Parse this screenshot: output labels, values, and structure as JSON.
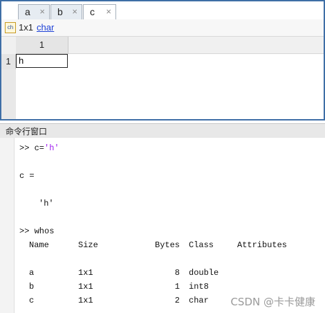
{
  "tabs": [
    {
      "label": "a",
      "active": false
    },
    {
      "label": "b",
      "active": false
    },
    {
      "label": "c",
      "active": true
    }
  ],
  "tab_close_glyph": "×",
  "variable_info": {
    "icon": "char-icon",
    "icon_text": "ch",
    "size": "1x1",
    "class": "char"
  },
  "grid": {
    "column_header": "1",
    "row_header": "1",
    "cell_value": "h"
  },
  "command_window": {
    "title": "命令行窗口",
    "prompt": ">>",
    "cmd1": "c=",
    "cmd1_string": "'h'",
    "out_name": "c =",
    "out_value": "'h'",
    "cmd2": "whos",
    "whos_headers": [
      "Name",
      "Size",
      "Bytes",
      "Class",
      "Attributes"
    ],
    "whos_rows": [
      {
        "name": "a",
        "size": "1x1",
        "bytes": "8",
        "class": "double"
      },
      {
        "name": "b",
        "size": "1x1",
        "bytes": "1",
        "class": "int8"
      },
      {
        "name": "c",
        "size": "1x1",
        "bytes": "2",
        "class": "char"
      }
    ]
  },
  "watermark": "CSDN @卡卡健康",
  "colors": {
    "panel_border": "#3e6ea6",
    "string": "#a020f0",
    "link": "#1b3fd6"
  }
}
